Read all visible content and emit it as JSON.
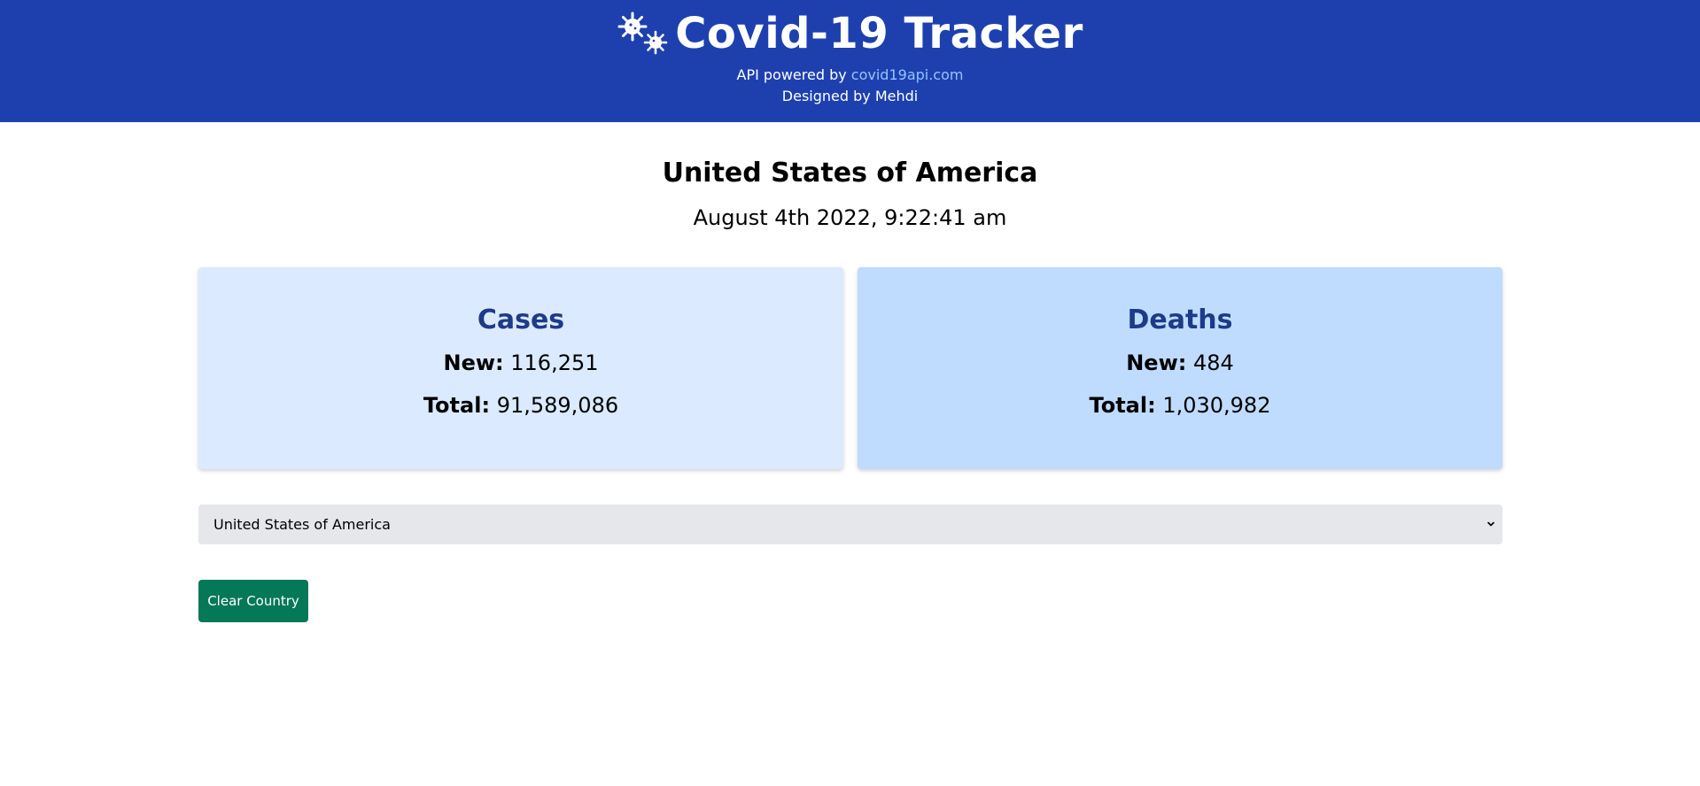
{
  "header": {
    "title": "Covid-19 Tracker",
    "logo_icon": "virus-icon",
    "api_prefix": "API powered by ",
    "api_link": "covid19api.com",
    "designed_by": "Designed by Mehdi",
    "background_color": "#1e40af",
    "link_color": "#93c5fd"
  },
  "main": {
    "country": "United States of America",
    "date": "August 4th 2022, 9:22:41 am"
  },
  "cards": {
    "cases": {
      "title": "Cases",
      "new_label": "New:",
      "new_value": "116,251",
      "total_label": "Total:",
      "total_value": "91,589,086",
      "background_color": "#dbeafe"
    },
    "deaths": {
      "title": "Deaths",
      "new_label": "New:",
      "new_value": "484",
      "total_label": "Total:",
      "total_value": "1,030,982",
      "background_color": "#bfdbfe"
    }
  },
  "country_select": {
    "selected": "United States of America",
    "icon": "chevron-down-icon"
  },
  "clear_button": {
    "label": "Clear Country",
    "color": "#047857"
  }
}
